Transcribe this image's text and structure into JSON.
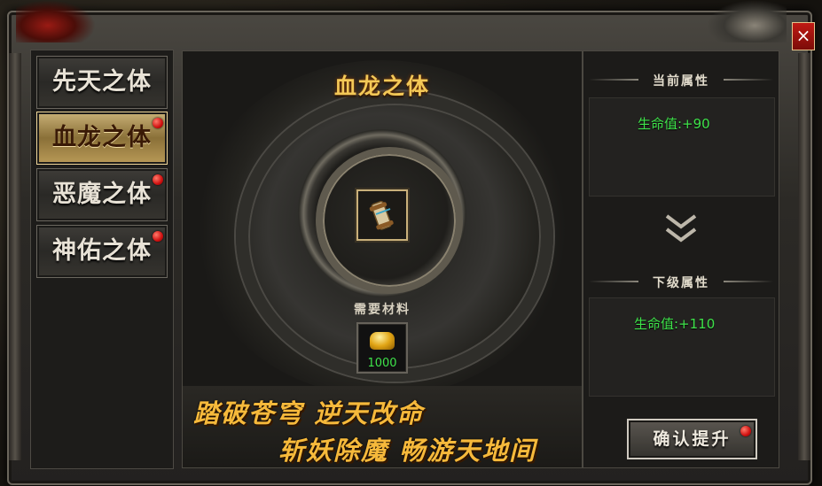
{
  "tabs": [
    {
      "label": "先天之体",
      "active": false,
      "badge": false
    },
    {
      "label": "血龙之体",
      "active": true,
      "badge": true
    },
    {
      "label": "恶魔之体",
      "active": false,
      "badge": true
    },
    {
      "label": "神佑之体",
      "active": false,
      "badge": true
    }
  ],
  "center": {
    "title": "血龙之体",
    "item_icon": "scroll-icon",
    "material_label": "需要材料",
    "material_icon": "gold-ingot-icon",
    "material_count": "1000",
    "slogan_line1": "踏破苍穹  逆天改命",
    "slogan_line2": "斩妖除魔  畅游天地间"
  },
  "current": {
    "title": "当前属性",
    "stat": "生命值:+90"
  },
  "next": {
    "title": "下级属性",
    "stat": "生命值:+110"
  },
  "confirm_label": "确认提升",
  "close_label": "×",
  "colors": {
    "stat_green": "#3ee24a",
    "title_gold": "#f3c857",
    "badge_red": "#d01010"
  }
}
